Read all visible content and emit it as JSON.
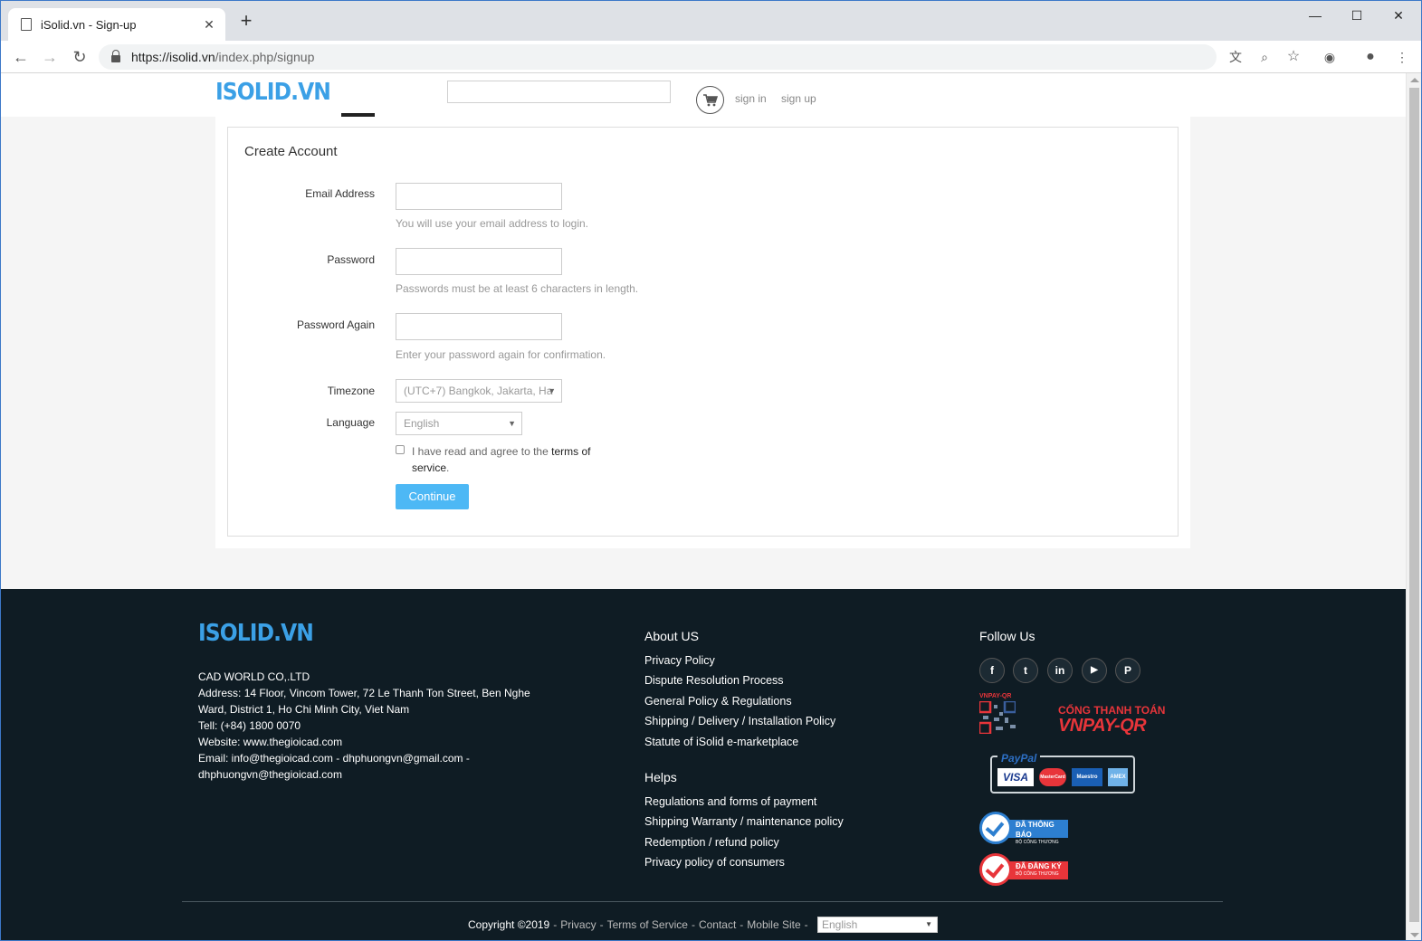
{
  "browser": {
    "tab_title": "iSolid.vn - Sign-up",
    "url_host": "https://isolid.vn",
    "url_path": "/index.php/signup",
    "new_tab_label": "+"
  },
  "header": {
    "logo": "ISOLID.VN",
    "search_placeholder": "",
    "sign_in": "sign in",
    "sign_up": "sign up"
  },
  "form": {
    "title": "Create Account",
    "email_label": "Email Address",
    "email_help": "You will use your email address to login.",
    "password_label": "Password",
    "password_help": "Passwords must be at least 6 characters in length.",
    "password_again_label": "Password Again",
    "password_again_help": "Enter your password again for confirmation.",
    "timezone_label": "Timezone",
    "timezone_value": "(UTC+7) Bangkok, Jakarta, Ha",
    "language_label": "Language",
    "language_value": "English",
    "agree_text": "I have read and agree to the ",
    "terms_link": "terms of service",
    "agree_end": ".",
    "continue_label": "Continue"
  },
  "footer": {
    "logo": "ISOLID.VN",
    "company": {
      "name": "CAD WORLD CO,.LTD",
      "address": "Address: 14 Floor, Vincom Tower, 72 Le Thanh Ton Street, Ben Nghe Ward, District 1, Ho Chi Minh City, Viet Nam",
      "tel": "Tell: (+84) 1800 0070",
      "website": "Website: www.thegioicad.com",
      "email": "Email: info@thegioicad.com - dhphuongvn@gmail.com - dhphuongvn@thegioicad.com"
    },
    "about_heading": "About US",
    "about_links": [
      "Privacy Policy",
      "Dispute Resolution Process",
      "General Policy & Regulations",
      "Shipping / Delivery / Installation Policy",
      "Statute of iSolid e-marketplace"
    ],
    "helps_heading": "Helps",
    "helps_links": [
      "Regulations and forms of payment",
      "Shipping Warranty / maintenance policy",
      "Redemption / refund policy",
      "Privacy policy of consumers"
    ],
    "follow_heading": "Follow Us",
    "social": [
      "f",
      "t",
      "in",
      "▶",
      "P"
    ],
    "vnpay_small": "VNPAY-QR",
    "vnpay_caption": "CỔNG THANH TOÁN",
    "vnpay_big": "VNPAY-QR",
    "paypal_label": "PayPal",
    "cards": [
      "VISA",
      "MasterCard",
      "Maestro",
      "AMEX"
    ],
    "badge_notified": "ĐÃ THÔNG BÁO",
    "badge_notified_sub": "BỘ CÔNG THƯƠNG",
    "badge_registered": "ĐÃ ĐĂNG KÝ",
    "badge_registered_sub": "BỘ CÔNG THƯƠNG",
    "copyright": "Copyright ©2019",
    "bottom_links": [
      "Privacy",
      "Terms of Service",
      "Contact",
      "Mobile Site"
    ],
    "language_value": "English"
  },
  "colors": {
    "brand": "#3ba0e6",
    "button": "#4db8f5",
    "footer_bg": "#0f1c24",
    "vnpay_red": "#e8353a"
  }
}
